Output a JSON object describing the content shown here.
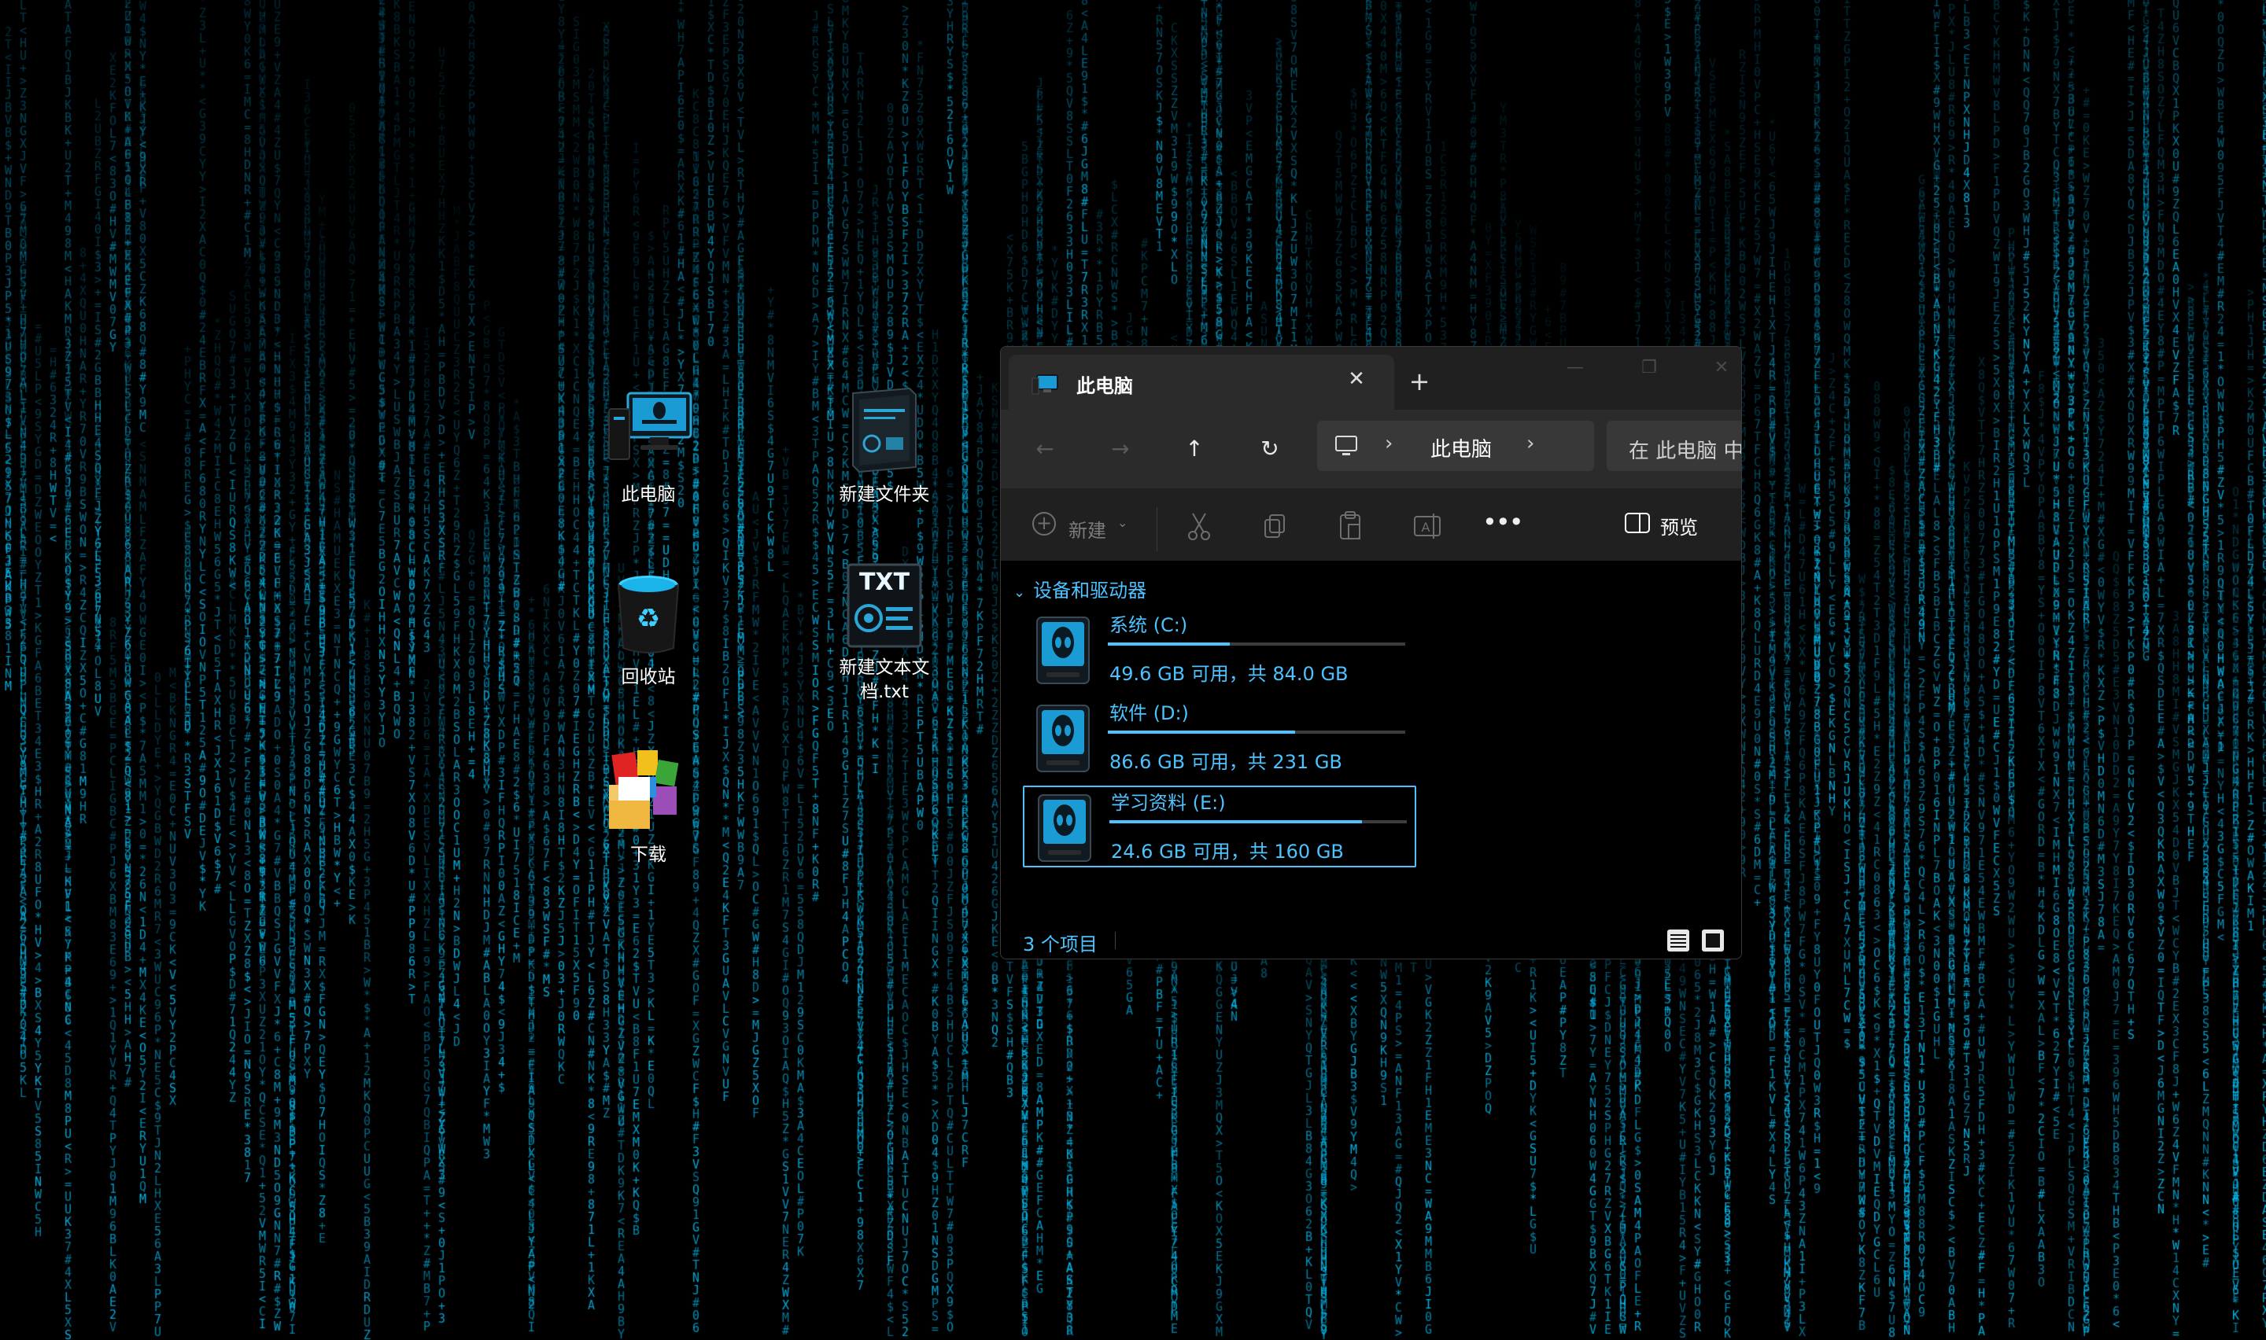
{
  "desktop": {
    "icons": [
      {
        "label": "此电脑",
        "icon": "alienware-computer-icon"
      },
      {
        "label": "回收站",
        "icon": "recycle-bin-icon"
      },
      {
        "label": "下载",
        "icon": "download-boxes-icon"
      },
      {
        "label": "新建文件夹",
        "icon": "folder-tower-icon"
      },
      {
        "label": "新建文本文档.txt",
        "icon": "txt-file-icon"
      }
    ],
    "wallpaper_color": "#00b4e6"
  },
  "explorer": {
    "tab_title": "此电脑",
    "tab_close": "✕",
    "new_tab": "+",
    "window_controls": {
      "minimize": "—",
      "maximize": "❐",
      "close": "✕"
    },
    "nav": {
      "back": "←",
      "forward": "→",
      "up": "↑",
      "refresh": "↻"
    },
    "address": {
      "separator": "›",
      "crumb": "此电脑"
    },
    "search_placeholder": "在 此电脑 中搜索",
    "toolbar": {
      "new_label": "新建",
      "more": "•••",
      "preview_label": "预览"
    },
    "section_title": "设备和驱动器",
    "drives": [
      {
        "name": "系统 (C:)",
        "info": "49.6 GB 可用，共 84.0 GB",
        "used_fraction": 0.41
      },
      {
        "name": "软件 (D:)",
        "info": "86.6 GB 可用，共 231 GB",
        "used_fraction": 0.63
      },
      {
        "name": "学习资料 (E:)",
        "info": "24.6 GB 可用，共 160 GB",
        "used_fraction": 0.85
      }
    ],
    "status": {
      "item_count": "3 个项目"
    },
    "colors": {
      "accent": "#4cc2ff",
      "window_bg": "#202020",
      "content_bg": "#000000"
    }
  }
}
